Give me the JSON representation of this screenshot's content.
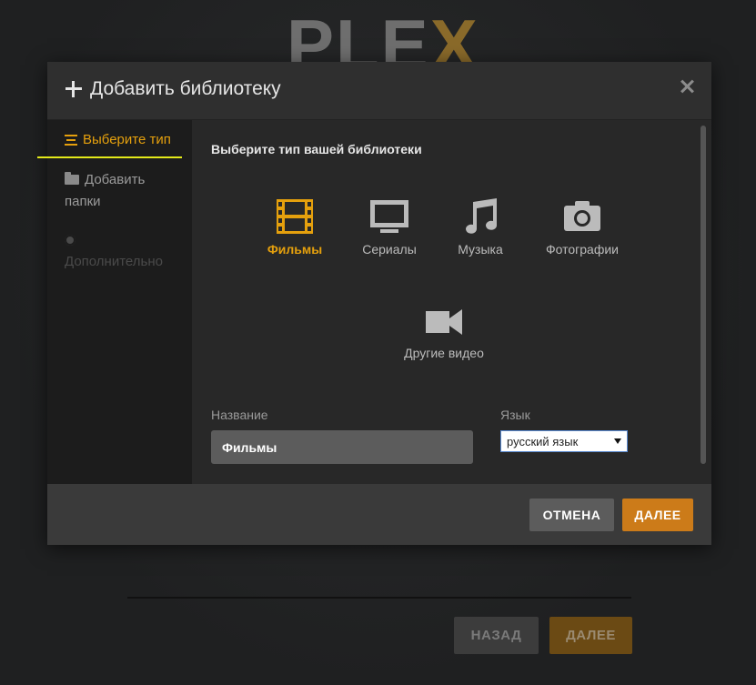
{
  "background": {
    "logo_plain": "PLE",
    "logo_accent": "X",
    "back_label": "НАЗАД",
    "next_label": "ДАЛЕЕ"
  },
  "modal": {
    "title": "Добавить библиотеку",
    "sidebar": {
      "items": [
        {
          "label": "Выберите тип",
          "icon": "list-icon",
          "state": "active"
        },
        {
          "label": "Добавить папки",
          "icon": "folder-icon",
          "state": "enabled"
        },
        {
          "label": "Дополнительно",
          "icon": "gear-icon",
          "state": "disabled"
        }
      ]
    },
    "content": {
      "heading": "Выберите тип вашей библиотеки",
      "types": [
        {
          "label": "Фильмы",
          "icon": "film-icon",
          "selected": true
        },
        {
          "label": "Сериалы",
          "icon": "tv-icon",
          "selected": false
        },
        {
          "label": "Музыка",
          "icon": "music-icon",
          "selected": false
        },
        {
          "label": "Фотографии",
          "icon": "camera-icon",
          "selected": false
        },
        {
          "label": "Другие видео",
          "icon": "video-camera-icon",
          "selected": false
        }
      ],
      "name_label": "Название",
      "name_value": "Фильмы",
      "language_label": "Язык",
      "language_value": "русский язык"
    },
    "footer": {
      "cancel_label": "ОТМЕНА",
      "next_label": "ДАЛЕЕ"
    }
  },
  "colors": {
    "accent": "#e5a00d",
    "next_button": "#cc7b19",
    "highlight_line": "#e4ea1a"
  }
}
